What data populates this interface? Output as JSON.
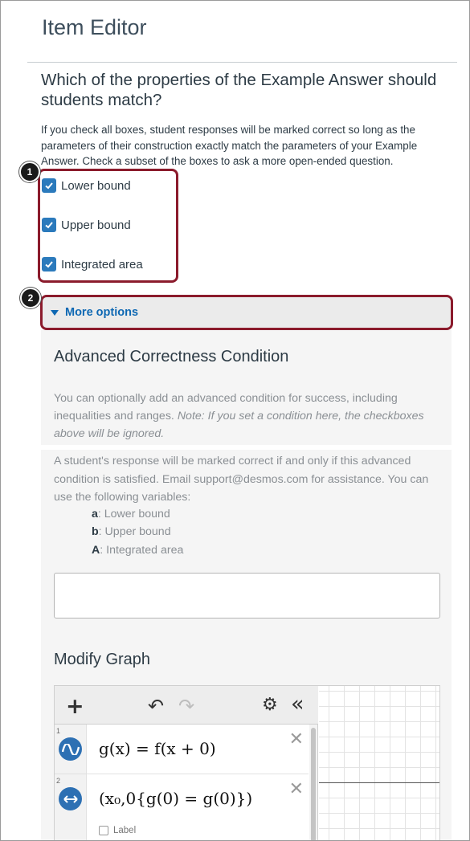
{
  "page": {
    "title": "Item Editor",
    "question": "Which of the properties of the Example Answer should students match?",
    "instructions": "If you check all boxes, student responses will be marked correct so long as the parameters of their construction exactly match the parameters of your Example Answer. Check a subset of the boxes to ask a more open-ended question."
  },
  "callouts": [
    "1",
    "2"
  ],
  "properties": [
    {
      "label": "Lower bound",
      "checked": true
    },
    {
      "label": "Upper bound",
      "checked": true
    },
    {
      "label": "Integrated area",
      "checked": true
    }
  ],
  "more_options": {
    "label": "More options"
  },
  "advanced": {
    "title": "Advanced Correctness Condition",
    "desc_plain": "You can optionally add an advanced condition for success, including inequalities and ranges. ",
    "desc_note": "Note: If you set a condition here, the checkboxes above will be ignored.",
    "desc2": "A student's response will be marked correct if and only if this advanced condition is satisfied. Email support@desmos.com for assistance. You can use the following variables:",
    "variables": [
      {
        "symbol": "a",
        "text": ": Lower bound"
      },
      {
        "symbol": "b",
        "text": ": Upper bound"
      },
      {
        "symbol": "A",
        "text": ": Integrated area"
      }
    ],
    "condition_value": ""
  },
  "modify_graph": {
    "title": "Modify Graph",
    "toolbar": {
      "add": "+",
      "undo": "↶",
      "redo": "↷",
      "settings": "⚙",
      "collapse": "«"
    },
    "expressions": [
      {
        "num": "1",
        "icon": "wave-icon",
        "latex": "g(x) = f(x + 0)"
      },
      {
        "num": "2",
        "icon": "horizontal-arrows-icon",
        "latex": "(x₀,0{g(0) = g(0)})",
        "label_text": "Label"
      }
    ],
    "delete_glyph": "✕"
  },
  "colors": {
    "accent": "#2b7abc",
    "link": "#0e68b3",
    "callout": "#8b1b2c",
    "expr_icon": "#2d70b3"
  }
}
